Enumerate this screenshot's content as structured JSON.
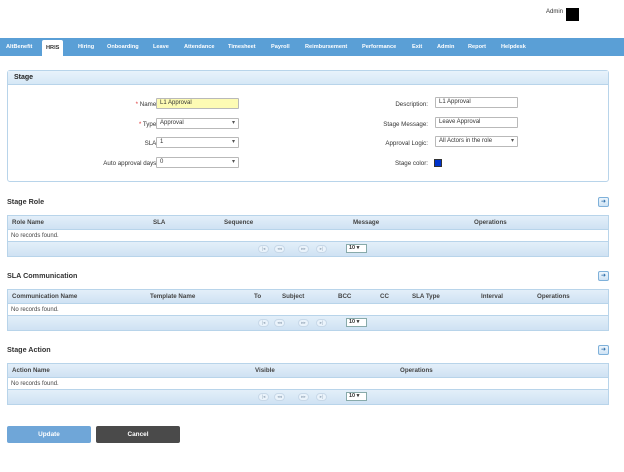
{
  "header": {
    "admin_label": "Admin"
  },
  "nav": {
    "items": [
      "AltBenefit",
      "HRIS",
      "Hiring",
      "Onboarding",
      "Leave",
      "Attendance",
      "Timesheet",
      "Payroll",
      "Reimbursement",
      "Performance",
      "Exit",
      "Admin",
      "Report",
      "Helpdesk"
    ],
    "active": "HRIS"
  },
  "stage": {
    "title": "Stage",
    "name_label": "Name:",
    "name_value": "L1 Approval",
    "type_label": "Type:",
    "type_value": "Approval",
    "sla_label": "SLA:",
    "sla_value": "1",
    "auto_label": "Auto approval days:",
    "auto_value": "0",
    "desc_label": "Description:",
    "desc_value": "L1 Approval",
    "msg_label": "Stage Message:",
    "msg_value": "Leave Approval",
    "logic_label": "Approval Logic:",
    "logic_value": "All Actors in the role",
    "color_label": "Stage color:",
    "color_value": "#0033cc",
    "required_mark": "*"
  },
  "stage_role": {
    "title": "Stage Role",
    "columns": [
      "Role Name",
      "SLA",
      "Sequence",
      "Message",
      "Operations"
    ],
    "empty": "No records found."
  },
  "sla_comm": {
    "title": "SLA Communication",
    "columns": [
      "Communication Name",
      "Template Name",
      "To",
      "Subject",
      "BCC",
      "CC",
      "SLA Type",
      "Interval",
      "Operations"
    ],
    "empty": "No records found."
  },
  "stage_action": {
    "title": "Stage Action",
    "columns": [
      "Action Name",
      "Visible",
      "Operations"
    ],
    "empty": "No records found."
  },
  "pager": {
    "first": "|◂",
    "prev": "◂◂",
    "next": "▸▸",
    "last": "▸|",
    "page_size": "10 ▾"
  },
  "buttons": {
    "update": "Update",
    "cancel": "Cancel"
  }
}
